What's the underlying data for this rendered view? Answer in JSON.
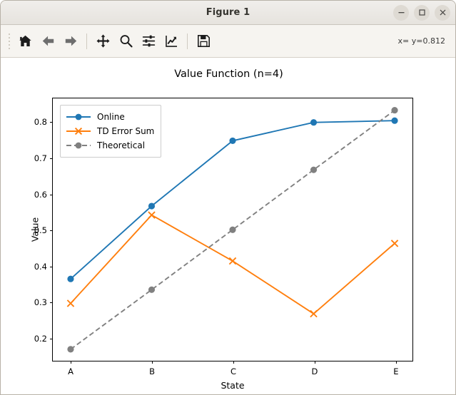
{
  "window": {
    "title": "Figure 1",
    "buttons": [
      {
        "name": "minimize",
        "glyph": "minimize-icon"
      },
      {
        "name": "maximize",
        "glyph": "maximize-icon"
      },
      {
        "name": "close",
        "glyph": "close-icon"
      }
    ]
  },
  "toolbar": {
    "items": [
      {
        "name": "home-icon",
        "tooltip": "Reset original view"
      },
      {
        "name": "back-arrow-icon",
        "tooltip": "Back to previous view"
      },
      {
        "name": "forward-arrow-icon",
        "tooltip": "Forward to next view"
      },
      {
        "name": "pan-move-icon",
        "tooltip": "Pan axes with left mouse, zoom with right"
      },
      {
        "name": "zoom-magnifier-icon",
        "tooltip": "Zoom to rectangle"
      },
      {
        "name": "configure-subplots-sliders-icon",
        "tooltip": "Configure subplots"
      },
      {
        "name": "edit-axis-curve-icon",
        "tooltip": "Edit axis, curve and image parameters"
      },
      {
        "name": "save-floppy-icon",
        "tooltip": "Save the figure"
      }
    ],
    "status": "x= y=0.812"
  },
  "chart_data": {
    "type": "line",
    "title": "Value Function (n=4)",
    "xlabel": "State",
    "ylabel": "Value",
    "categories": [
      "A",
      "B",
      "C",
      "D",
      "E"
    ],
    "xticklabels": [
      "A",
      "B",
      "C",
      "D",
      "E"
    ],
    "yticks": [
      0.2,
      0.3,
      0.4,
      0.5,
      0.6,
      0.7,
      0.8
    ],
    "yticklabels": [
      "0.2",
      "0.3",
      "0.4",
      "0.5",
      "0.6",
      "0.7",
      "0.8"
    ],
    "ylim": [
      0.135,
      0.866
    ],
    "xlim": [
      -0.22,
      4.22
    ],
    "grid": false,
    "legend_position": "upper left",
    "series": [
      {
        "name": "Online",
        "color": "#1f77b4",
        "linestyle": "solid",
        "marker": "circle",
        "values": [
          0.363,
          0.566,
          0.748,
          0.799,
          0.804
        ]
      },
      {
        "name": "TD Error Sum",
        "color": "#ff7f0e",
        "linestyle": "solid",
        "marker": "x",
        "values": [
          0.295,
          0.541,
          0.413,
          0.266,
          0.462
        ]
      },
      {
        "name": "Theoretical",
        "color": "#808080",
        "linestyle": "dashed",
        "marker": "circle",
        "values": [
          0.167,
          0.333,
          0.5,
          0.667,
          0.833
        ]
      }
    ]
  }
}
